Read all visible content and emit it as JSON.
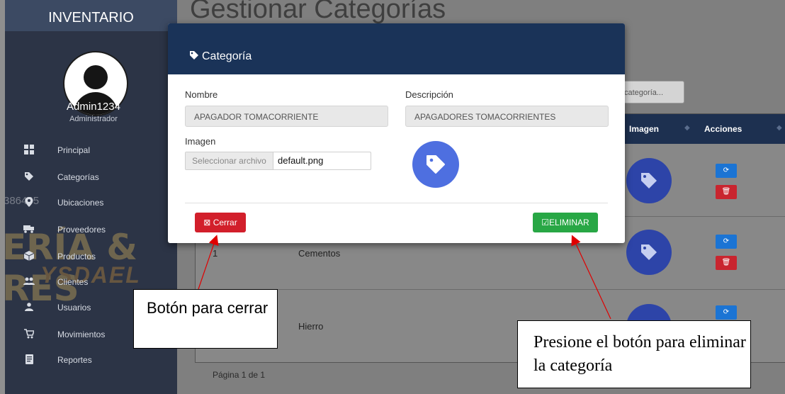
{
  "sidebar": {
    "title": "INVENTARIO",
    "user_name": "Admin1234",
    "user_role": "Administrador",
    "watermark_numbers": "386465",
    "watermark_text": "ERÍA & RES",
    "watermark_brand": "YSDAEL",
    "items": [
      {
        "label": "Principal",
        "icon": "dashboard-icon"
      },
      {
        "label": "Categorías",
        "icon": "tag-icon"
      },
      {
        "label": "Ubicaciones",
        "icon": "location-icon"
      },
      {
        "label": "Proveedores",
        "icon": "truck-icon"
      },
      {
        "label": "Productos",
        "icon": "box-icon"
      },
      {
        "label": "Clientes",
        "icon": "users-icon"
      },
      {
        "label": "Usuarios",
        "icon": "user-icon"
      },
      {
        "label": "Movimientos",
        "icon": "cart-icon"
      },
      {
        "label": "Reportes",
        "icon": "report-icon"
      }
    ]
  },
  "main": {
    "title": "Gestionar Categorías",
    "search_placeholder": "categoría...",
    "table": {
      "headers": {
        "imagen": "Imagen",
        "acciones": "Acciones"
      },
      "rows": [
        {
          "id": "",
          "name": ""
        },
        {
          "id": "1",
          "name": "Cementos"
        },
        {
          "id": "",
          "name": "Hierro"
        }
      ]
    },
    "pagination": "Página 1 de 1"
  },
  "modal": {
    "title": "Categoría",
    "nombre_label": "Nombre",
    "nombre_value": "APAGADOR TOMACORRIENTE",
    "descripcion_label": "Descripción",
    "descripcion_value": "APAGADORES TOMACORRIENTES",
    "imagen_label": "Imagen",
    "file_button": "Seleccionar archivo",
    "file_name": "default.png",
    "close_button": "Cerrar",
    "delete_button": "ELIMINAR"
  },
  "annotations": {
    "close_note": "Botón para cerrar",
    "delete_note": "Presione el botón para eliminar la categoría"
  },
  "colors": {
    "sidebar": "#2c3446",
    "modal_header": "#1a3358",
    "close": "#d21f2b",
    "delete": "#28a745",
    "edit": "#1b74d4",
    "tag_preview": "#4e6fe0"
  }
}
